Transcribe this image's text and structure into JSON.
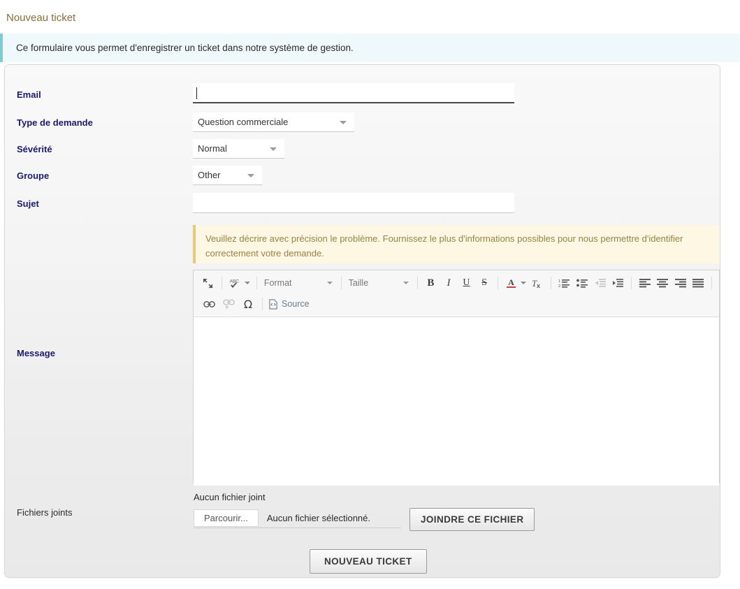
{
  "page": {
    "title": "Nouveau ticket"
  },
  "info_alert": {
    "text": "Ce formulaire vous permet d'enregistrer un ticket dans notre système de gestion."
  },
  "form": {
    "fields": {
      "email": {
        "label": "Email",
        "value": "",
        "placeholder": ""
      },
      "request_type": {
        "label": "Type de demande",
        "value": "Question commerciale"
      },
      "severity": {
        "label": "Sévérité",
        "value": "Normal"
      },
      "group": {
        "label": "Groupe",
        "value": "Other"
      },
      "subject": {
        "label": "Sujet",
        "value": "",
        "placeholder": ""
      },
      "message": {
        "label": "Message",
        "value": ""
      },
      "attachments": {
        "label": "Fichiers joints"
      }
    },
    "message_hint": "Veuillez décrire avec précision le problème. Fournissez le plus d'informations possibles pour nous permettre d'identifier correctement votre demande."
  },
  "editor": {
    "toolbar": {
      "maximize": "Agrandir",
      "spellcheck": "Vérification orthographique",
      "format_label": "Format",
      "size_label": "Taille",
      "bold": "B",
      "italic": "I",
      "underline": "U",
      "strike": "S",
      "text_color": "A",
      "remove_format": "Supprimer le format",
      "numbered_list": "Liste numérotée",
      "bulleted_list": "Liste à puces",
      "outdent": "Diminuer le retrait",
      "indent": "Augmenter le retrait",
      "align_left": "Aligner à gauche",
      "align_center": "Centrer",
      "align_right": "Aligner à droite",
      "justify": "Justifier",
      "link": "Lien",
      "unlink": "Supprimer le lien",
      "special_char": "Ω",
      "source_label": "Source"
    },
    "content": ""
  },
  "attachments": {
    "none_text": "Aucun fichier joint",
    "browse_label": "Parcourir...",
    "selected_text": "Aucun fichier sélectionné.",
    "attach_button": "JOINDRE CE FICHIER"
  },
  "actions": {
    "submit_label": "NOUVEAU TICKET"
  },
  "colors": {
    "title": "#8a6d3b",
    "info_bg": "#eff8fb",
    "info_accent": "#7ecbd4",
    "warning_bg": "#fdf7e3",
    "warning_accent": "#e8c87a",
    "warning_text": "#9a8246",
    "label": "#1a1a6e"
  }
}
